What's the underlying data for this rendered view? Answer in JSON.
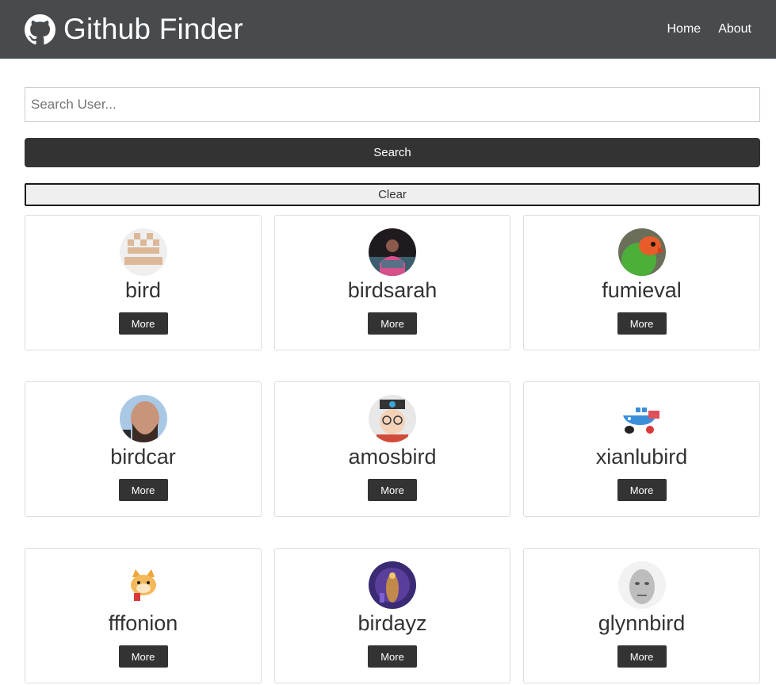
{
  "navbar": {
    "title": "Github Finder",
    "brand_icon": "github-icon",
    "links": [
      {
        "label": "Home"
      },
      {
        "label": "About"
      }
    ],
    "background": "#474b4e"
  },
  "search": {
    "placeholder": "Search User...",
    "value": "",
    "search_label": "Search",
    "clear_label": "Clear"
  },
  "users": [
    {
      "login": "bird",
      "more_label": "More",
      "avatar": "pixel-identicon-avatar"
    },
    {
      "login": "birdsarah",
      "more_label": "More",
      "avatar": "photo-avatar"
    },
    {
      "login": "fumieval",
      "more_label": "More",
      "avatar": "parrot-avatar"
    },
    {
      "login": "birdcar",
      "more_label": "More",
      "avatar": "photo-avatar"
    },
    {
      "login": "amosbird",
      "more_label": "More",
      "avatar": "cartoon-avatar"
    },
    {
      "login": "xianlubird",
      "more_label": "More",
      "avatar": "docker-whale-avatar"
    },
    {
      "login": "fffonion",
      "more_label": "More",
      "avatar": "doge-avatar"
    },
    {
      "login": "birdayz",
      "more_label": "More",
      "avatar": "photo-avatar"
    },
    {
      "login": "glynnbird",
      "more_label": "More",
      "avatar": "grayscale-face-avatar"
    }
  ],
  "colors": {
    "button_dark": "#333333",
    "clear_bg": "#efefef",
    "card_border": "#dddddd"
  }
}
